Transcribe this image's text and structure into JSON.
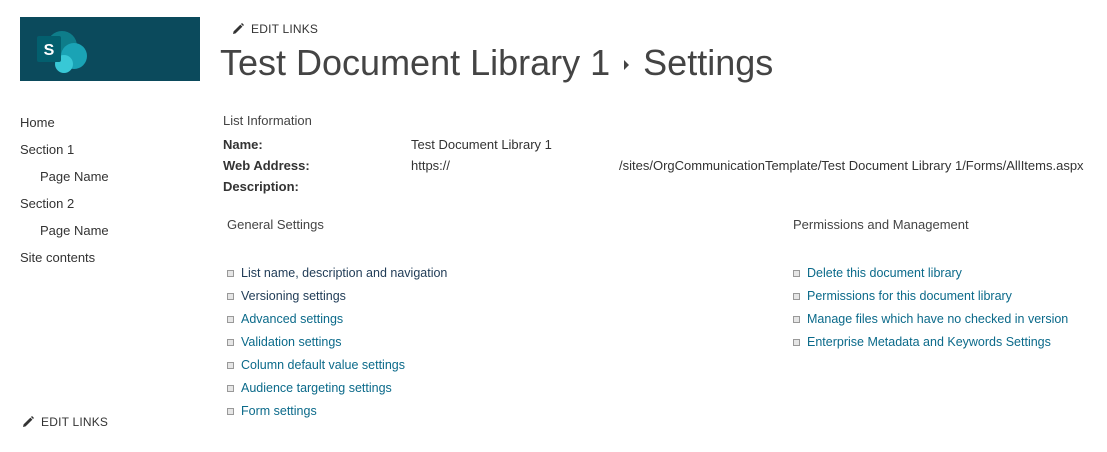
{
  "header": {
    "edit_links_label": "EDIT LINKS",
    "title": "Test Document Library 1",
    "title_page": "Settings",
    "logo_letter": "S"
  },
  "nav": {
    "items": [
      {
        "label": "Home"
      },
      {
        "label": "Section 1"
      },
      {
        "label": "Page Name"
      },
      {
        "label": "Section 2"
      },
      {
        "label": "Page Name"
      },
      {
        "label": "Site contents"
      }
    ],
    "edit_links_label": "EDIT LINKS"
  },
  "list_info": {
    "heading": "List Information",
    "name_label": "Name:",
    "name_value": "Test Document Library 1",
    "web_address_label": "Web Address:",
    "web_address_prefix": "https://",
    "web_address_suffix": "/sites/OrgCommunicationTemplate/Test Document Library 1/Forms/AllItems.aspx",
    "description_label": "Description:"
  },
  "general_settings": {
    "heading": "General Settings",
    "links": [
      "List name, description and navigation",
      "Versioning settings",
      "Advanced settings",
      "Validation settings",
      "Column default value settings",
      "Audience targeting settings",
      "Form settings"
    ]
  },
  "permissions": {
    "heading": "Permissions and Management",
    "links": [
      "Delete this document library",
      "Permissions for this document library",
      "Manage files which have no checked in version",
      "Enterprise Metadata and Keywords Settings"
    ]
  },
  "colors": {
    "logo_bg": "#0b4a5c",
    "link": "#0b6a8a",
    "text": "#333333"
  }
}
